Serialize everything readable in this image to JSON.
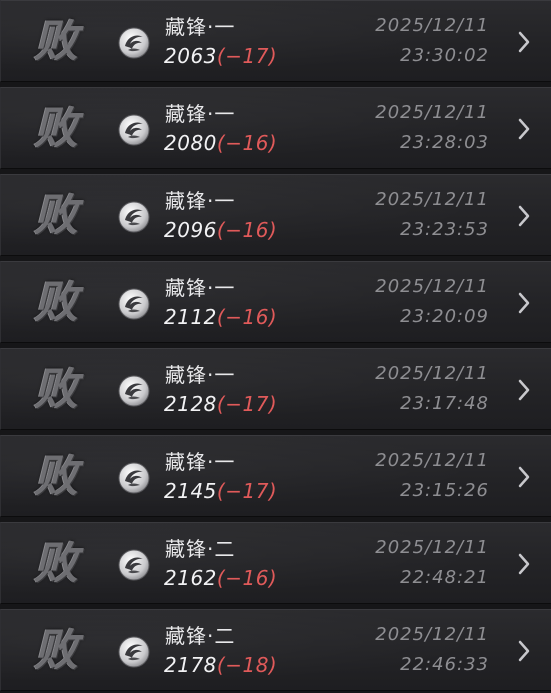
{
  "records": [
    {
      "result": "败",
      "name": "藏锋·一",
      "score": "2063",
      "delta": "(−17)",
      "date": "2025/12/11",
      "time": "23:30:02"
    },
    {
      "result": "败",
      "name": "藏锋·一",
      "score": "2080",
      "delta": "(−16)",
      "date": "2025/12/11",
      "time": "23:28:03"
    },
    {
      "result": "败",
      "name": "藏锋·一",
      "score": "2096",
      "delta": "(−16)",
      "date": "2025/12/11",
      "time": "23:23:53"
    },
    {
      "result": "败",
      "name": "藏锋·一",
      "score": "2112",
      "delta": "(−16)",
      "date": "2025/12/11",
      "time": "23:20:09"
    },
    {
      "result": "败",
      "name": "藏锋·一",
      "score": "2128",
      "delta": "(−17)",
      "date": "2025/12/11",
      "time": "23:17:48"
    },
    {
      "result": "败",
      "name": "藏锋·一",
      "score": "2145",
      "delta": "(−17)",
      "date": "2025/12/11",
      "time": "23:15:26"
    },
    {
      "result": "败",
      "name": "藏锋·二",
      "score": "2162",
      "delta": "(−16)",
      "date": "2025/12/11",
      "time": "22:48:21"
    },
    {
      "result": "败",
      "name": "藏锋·二",
      "score": "2178",
      "delta": "(−18)",
      "date": "2025/12/11",
      "time": "22:46:33"
    }
  ],
  "icons": {
    "rank": "rank-emblem-icon",
    "arrow": "chevron-right-icon"
  },
  "colors": {
    "delta_negative": "#e05a5a",
    "timestamp": "#8e8e92",
    "text": "#f2f2f4"
  }
}
